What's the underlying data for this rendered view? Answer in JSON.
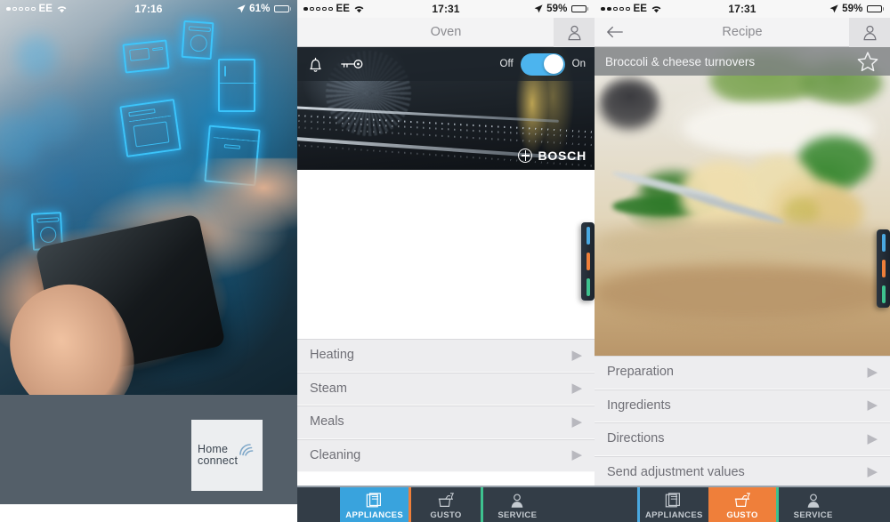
{
  "panels": {
    "left": {
      "statusbar": {
        "carrier": "EE",
        "time": "17:16",
        "battery_pct": "61%",
        "wifi_icon": "wifi-icon",
        "location_icon": "location-arrow-icon"
      },
      "hero_alt": "hand holding smartphone with glowing blue appliance icons",
      "logo": {
        "line1": "Home",
        "line2": "connect",
        "mark": "wifi-arcs-icon"
      }
    },
    "middle": {
      "statusbar": {
        "carrier": "EE",
        "time": "17:31",
        "battery_pct": "59%",
        "wifi_icon": "wifi-icon",
        "location_icon": "location-arrow-icon"
      },
      "navbar": {
        "title": "Oven",
        "profile_icon": "user-icon"
      },
      "appliance": {
        "alarm_icon": "bell-icon",
        "lock_icon": "key-icon",
        "toggle": {
          "off_label": "Off",
          "on_label": "On",
          "state": "on"
        },
        "brand": "BOSCH",
        "brand_mark": "bosch-logo-icon"
      },
      "menu": [
        {
          "label": "Heating",
          "chevron": "chevron-right-icon"
        },
        {
          "label": "Steam",
          "chevron": "chevron-right-icon"
        },
        {
          "label": "Meals",
          "chevron": "chevron-right-icon"
        },
        {
          "label": "Cleaning",
          "chevron": "chevron-right-icon"
        }
      ],
      "tabbar": {
        "active": "APPLIANCES",
        "tabs": [
          {
            "label": "APPLIANCES",
            "icon": "appliances-stack-icon"
          },
          {
            "label": "GUSTO",
            "icon": "pot-and-glass-icon"
          },
          {
            "label": "SERVICE",
            "icon": "user-service-icon"
          }
        ]
      },
      "side_handle": {
        "bars": [
          "#4aa8e0",
          "#ef7f3a",
          "#3ec28f"
        ]
      }
    },
    "right": {
      "statusbar": {
        "carrier": "EE",
        "time": "17:31",
        "battery_pct": "59%",
        "wifi_icon": "wifi-icon",
        "location_icon": "location-arrow-icon"
      },
      "navbar": {
        "back_icon": "arrow-left-icon",
        "title": "Recipe",
        "profile_icon": "user-icon"
      },
      "recipe": {
        "title": "Broccoli & cheese turnovers",
        "favorite_icon": "star-outline-icon",
        "photo_alt": "broccoli and cheese turnovers on a baking tray"
      },
      "menu": [
        {
          "label": "Preparation",
          "chevron": "chevron-right-icon"
        },
        {
          "label": "Ingredients",
          "chevron": "chevron-right-icon"
        },
        {
          "label": "Directions",
          "chevron": "chevron-right-icon"
        },
        {
          "label": "Send adjustment values",
          "chevron": "chevron-right-icon"
        }
      ],
      "tabbar": {
        "active": "GUSTO",
        "tabs": [
          {
            "label": "APPLIANCES",
            "icon": "appliances-stack-icon"
          },
          {
            "label": "GUSTO",
            "icon": "pot-and-glass-icon"
          },
          {
            "label": "SERVICE",
            "icon": "user-service-icon"
          }
        ]
      },
      "side_handle": {
        "bars": [
          "#4aa8e0",
          "#ef7f3a",
          "#3ec28f"
        ]
      }
    }
  },
  "colors": {
    "accent_blue": "#39a3dd",
    "accent_orange": "#ef7f3a",
    "accent_green": "#3ec28f",
    "tabbar_bg": "#333d47",
    "list_bg": "#ededef",
    "navbar_bg": "#f3f3f4"
  }
}
